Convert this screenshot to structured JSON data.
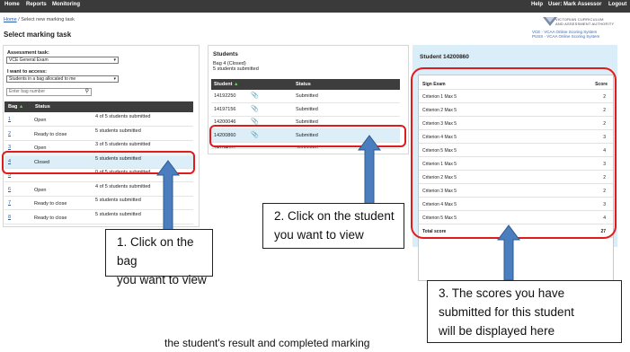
{
  "nav": {
    "home": "Home",
    "reports": "Reports",
    "monitoring": "Monitoring",
    "help": "Help",
    "user": "User: Mark Assessor",
    "logout": "Logout"
  },
  "breadcrumb": {
    "home": "Home",
    "separator": "/",
    "current": "Select new marking task"
  },
  "page_title": "Select marking task",
  "logo": {
    "org_line1": "VICTORIAN CURRICULUM",
    "org_line2": "AND ASSESSMENT AUTHORITY",
    "system_line1": "VCE - VCAA Online Scoring System",
    "system_line2": "PUSS - VCAA Online Scoring System"
  },
  "task_panel": {
    "assessment_label": "Assessment task:",
    "assessment_value": "VCE General Exam",
    "access_label": "I want to access:",
    "access_value": "Students in a bag allocated to me",
    "search_placeholder": "Enter bag number",
    "columns": {
      "bag": "Bag",
      "status": "Status"
    },
    "rows": [
      {
        "bag": "1",
        "status": "Open",
        "summary": "4 of 5 students submitted"
      },
      {
        "bag": "2",
        "status": "Ready to close",
        "summary": "5 students submitted"
      },
      {
        "bag": "3",
        "status": "Open",
        "summary": "3 of 5 students submitted"
      },
      {
        "bag": "4",
        "status": "Closed",
        "summary": "5 students submitted"
      },
      {
        "bag": "5",
        "status": "",
        "summary": "0 of 5 students submitted"
      },
      {
        "bag": "6",
        "status": "Open",
        "summary": "4 of 5 students submitted"
      },
      {
        "bag": "7",
        "status": "Ready to close",
        "summary": "5 students submitted"
      },
      {
        "bag": "8",
        "status": "Ready to close",
        "summary": "5 students submitted"
      }
    ]
  },
  "students_panel": {
    "title": "Students",
    "bag_info": "Bag 4 (Closed)",
    "submitted_info": "5 students submitted",
    "columns": {
      "student": "Student",
      "status": "Status"
    },
    "rows": [
      {
        "id": "14192250",
        "status": "Submitted"
      },
      {
        "id": "14197156",
        "status": "Submitted"
      },
      {
        "id": "14200046",
        "status": "Submitted"
      },
      {
        "id": "14200860",
        "status": "Submitted"
      },
      {
        "id": "14204081",
        "status": "Submitted"
      }
    ]
  },
  "score_panel": {
    "title": "Student 14200860",
    "columns": {
      "exam": "Sign Exam",
      "score": "Score"
    },
    "rows": [
      {
        "criterion": "Criterion 1 Max 5",
        "score": "2"
      },
      {
        "criterion": "Criterion 2 Max 5",
        "score": "2"
      },
      {
        "criterion": "Criterion 3 Max 5",
        "score": "2"
      },
      {
        "criterion": "Criterion 4 Max 5",
        "score": "3"
      },
      {
        "criterion": "Criterion 5 Max 5",
        "score": "4"
      },
      {
        "criterion": "Criterion 1 Max 5",
        "score": "3"
      },
      {
        "criterion": "Criterion 2 Max 5",
        "score": "2"
      },
      {
        "criterion": "Criterion 3 Max 5",
        "score": "2"
      },
      {
        "criterion": "Criterion 4 Max 5",
        "score": "3"
      },
      {
        "criterion": "Criterion 5 Max 5",
        "score": "4"
      }
    ],
    "total_label": "Total score",
    "total_value": "27"
  },
  "callouts": {
    "bag": [
      "1. Click on the bag",
      "you want to view"
    ],
    "student": [
      "2. Click on the student",
      "you want to view"
    ],
    "scores": [
      "3. The scores you have",
      "submitted for this student",
      "will be displayed here"
    ]
  },
  "caption": "the student's result and completed marking",
  "colors": {
    "highlight": "#e01b1b",
    "arrow_fill": "#4a7ebf",
    "arrow_stroke": "#2e5a8f",
    "score_panel_bg": "#d9eef8"
  }
}
